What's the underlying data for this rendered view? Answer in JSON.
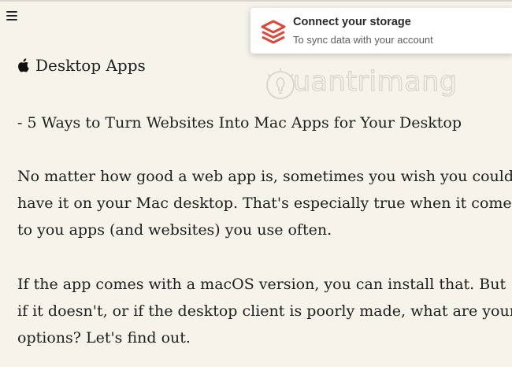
{
  "toast": {
    "title": "Connect your storage",
    "subtitle": "To sync data with your account",
    "icon": "layers-stack-icon",
    "accent": "#e0473a"
  },
  "watermark": {
    "text": "uantrimang"
  },
  "article": {
    "section_icon": "apple-icon",
    "section_title": "Desktop Apps",
    "subtitle": "- 5 Ways to Turn Websites Into Mac Apps for Your Desktop",
    "paragraph1": [
      "No matter how good a web app is, sometimes you wish you could",
      "have it on your Mac desktop. That's especially true when it comes",
      "to you apps (and websites) you use often."
    ],
    "paragraph2": [
      "If the app comes with a macOS version, you can install that. But",
      "if it doesn't, or if the desktop client is poorly made, what are your",
      "options? Let's find out."
    ]
  },
  "colors": {
    "background": "#f6f3ea",
    "text": "#1e1e1e"
  }
}
